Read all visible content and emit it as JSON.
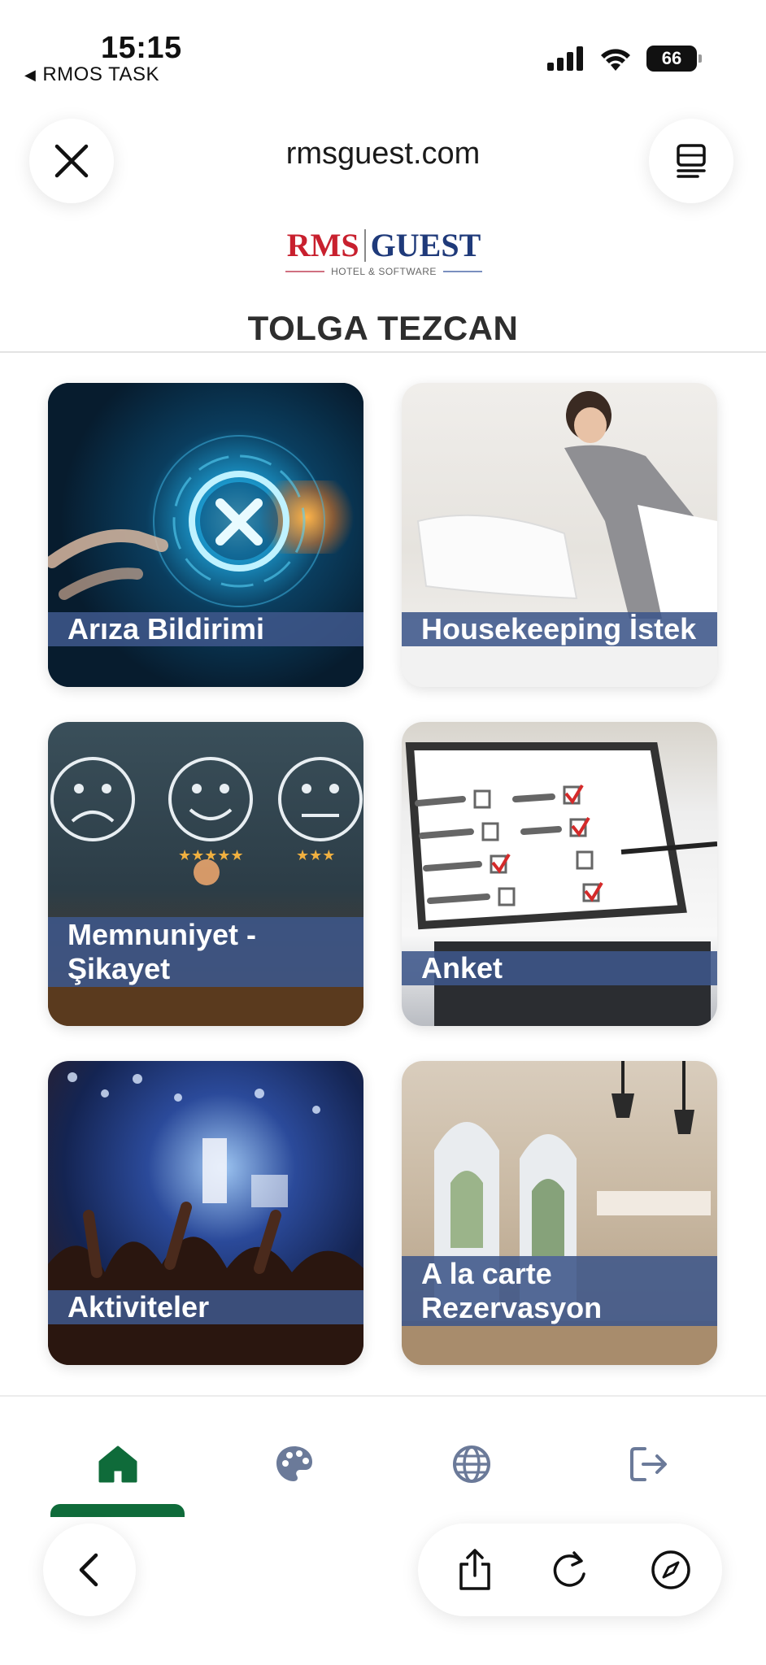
{
  "status_bar": {
    "time": "15:15",
    "back_app": "RMOS TASK",
    "battery": "66",
    "icons": [
      "signal-icon",
      "wifi-icon",
      "battery-icon"
    ]
  },
  "browser": {
    "url": "rmsguest.com",
    "close_icon": "close-icon",
    "tabs_icon": "tabs-icon"
  },
  "logo": {
    "rms": "RMS",
    "guest": "GUEST",
    "subtitle": "HOTEL & SOFTWARE"
  },
  "user": {
    "name": "TOLGA TEZCAN"
  },
  "cards": [
    {
      "label": "Arıza Bildirimi"
    },
    {
      "label": "Housekeeping İstek"
    },
    {
      "label": "Memnuniyet - Şikayet"
    },
    {
      "label": "Anket"
    },
    {
      "label": "Aktiviteler"
    },
    {
      "label": "A la carte Rezervasyon"
    }
  ],
  "app_nav": {
    "items": [
      "home-icon",
      "palette-icon",
      "globe-icon",
      "logout-icon"
    ],
    "active": "home",
    "active_color": "#0f6b3a",
    "icon_color": "#6b7a99"
  },
  "browser_toolbar": {
    "items": [
      "back-icon",
      "share-icon",
      "reload-icon",
      "compass-icon"
    ]
  }
}
